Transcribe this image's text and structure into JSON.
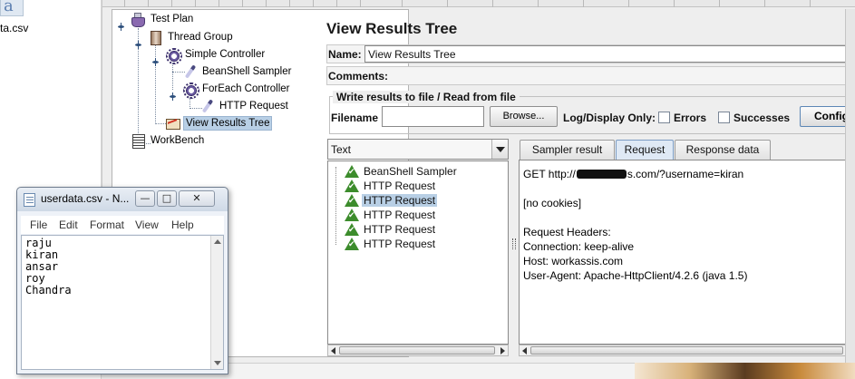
{
  "desktop": {
    "file_icon_label": "ta.csv",
    "file_icon_glyph": "a"
  },
  "tree": {
    "nodes": [
      {
        "label": "Test Plan",
        "icon": "test-plan-icon"
      },
      {
        "label": "Thread Group",
        "icon": "thread-group-icon"
      },
      {
        "label": "Simple Controller",
        "icon": "controller-icon"
      },
      {
        "label": "BeanShell Sampler",
        "icon": "sampler-icon"
      },
      {
        "label": "ForEach Controller",
        "icon": "controller-icon"
      },
      {
        "label": "HTTP Request",
        "icon": "sampler-icon"
      },
      {
        "label": "View Results Tree",
        "icon": "listener-icon"
      },
      {
        "label": "WorkBench",
        "icon": "workbench-icon"
      }
    ],
    "selected": "View Results Tree"
  },
  "panel": {
    "title": "View Results Tree",
    "name_label": "Name:",
    "name_value": "View Results Tree",
    "comments_label": "Comments:",
    "file_group_title": "Write results to file / Read from file",
    "filename_label": "Filename",
    "filename_value": "",
    "browse_label": "Browse...",
    "log_display_label": "Log/Display Only:",
    "errors_label": "Errors",
    "successes_label": "Successes",
    "configure_label": "Configure"
  },
  "results": {
    "renderer": "Text",
    "items": [
      {
        "label": "BeanShell Sampler",
        "status": "success"
      },
      {
        "label": "HTTP Request",
        "status": "success"
      },
      {
        "label": "HTTP Request",
        "status": "success"
      },
      {
        "label": "HTTP Request",
        "status": "success"
      },
      {
        "label": "HTTP Request",
        "status": "success"
      },
      {
        "label": "HTTP Request",
        "status": "success"
      }
    ],
    "selected_index": 2
  },
  "detail": {
    "tabs": [
      "Sampler result",
      "Request",
      "Response data"
    ],
    "active_tab": "Request",
    "get_prefix": "GET http://",
    "get_suffix": "s.com/?username=kiran",
    "cookies": "[no cookies]",
    "headers_title": "Request Headers:",
    "connection": "Connection: keep-alive",
    "host": "Host: workassis.com",
    "user_agent": "User-Agent: Apache-HttpClient/4.2.6 (java 1.5)"
  },
  "notepad": {
    "title": "userdata.csv - N...",
    "menu": [
      "File",
      "Edit",
      "Format",
      "View",
      "Help"
    ],
    "lines": [
      "raju",
      "kiran",
      "ansar",
      "roy",
      "Chandra"
    ],
    "minimize_glyph": "—",
    "maximize_glyph": "□",
    "close_glyph": "✕"
  },
  "colors": {
    "selection": "#b8cfe5",
    "success_green": "#3c8c2c",
    "panel_bg": "#eeeeee"
  }
}
